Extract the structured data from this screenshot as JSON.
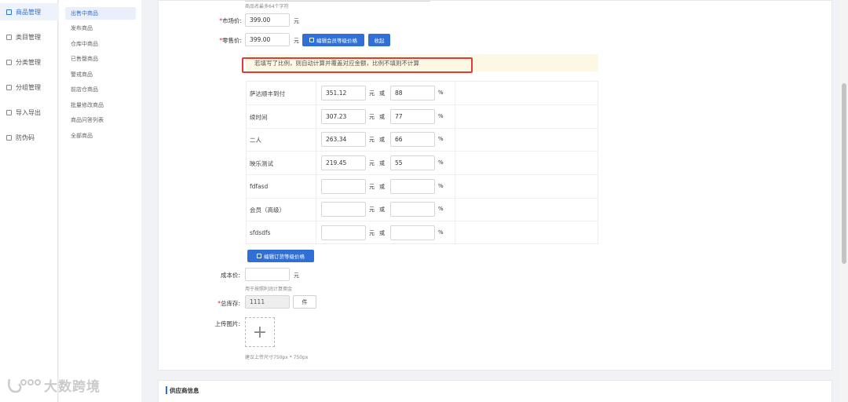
{
  "left_nav": [
    {
      "label": "商品管理",
      "icon": "goods-icon",
      "active": true
    },
    {
      "label": "类目管理",
      "icon": "category-icon",
      "active": false
    },
    {
      "label": "分类管理",
      "icon": "classify-icon",
      "active": false
    },
    {
      "label": "分组管理",
      "icon": "group-icon",
      "active": false
    },
    {
      "label": "导入导出",
      "icon": "import-export-icon",
      "active": false
    },
    {
      "label": "防伪码",
      "icon": "anti-fake-icon",
      "active": false
    }
  ],
  "sub_nav": [
    {
      "label": "出售中商品",
      "active": true
    },
    {
      "label": "发布商品",
      "active": false
    },
    {
      "label": "仓库中商品",
      "active": false
    },
    {
      "label": "已售罄商品",
      "active": false
    },
    {
      "label": "警戒商品",
      "active": false
    },
    {
      "label": "前店仓商品",
      "active": false
    },
    {
      "label": "批量修改商品",
      "active": false
    },
    {
      "label": "商品问答列表",
      "active": false
    },
    {
      "label": "全部商品",
      "active": false
    }
  ],
  "form": {
    "name_hint": "商品名最多64个字符",
    "market_price": {
      "required_mark": "*",
      "label": "市场价:",
      "value": "399.00",
      "unit": "元"
    },
    "retail_price": {
      "required_mark": "*",
      "label": "零售价:",
      "value": "399.00",
      "unit": "元"
    },
    "edit_member_price_button": "编辑会员等级价格",
    "collapse_button": "收起",
    "notice": "若填写了比例，则自动计算并覆盖对应金额，比例不填则不计算",
    "member_prices": [
      {
        "name": "萨达顺丰到付",
        "amount": "351.12",
        "percent": "88"
      },
      {
        "name": "续时间",
        "amount": "307.23",
        "percent": "77"
      },
      {
        "name": "二人",
        "amount": "263.34",
        "percent": "66"
      },
      {
        "name": "映乐测试",
        "amount": "219.45",
        "percent": "55"
      },
      {
        "name": "fdfasd",
        "amount": "",
        "percent": ""
      },
      {
        "name": "会员（高级）",
        "amount": "",
        "percent": ""
      },
      {
        "name": "sfdsdfs",
        "amount": "",
        "percent": ""
      }
    ],
    "yuan_unit": "元",
    "or_text": "或",
    "percent_sign": "%",
    "edit_order_price_button": "编辑订货等级价格",
    "cost_price": {
      "label": "成本价:",
      "value": "",
      "unit": "元",
      "hint": "用于按照利润计算佣金"
    },
    "total_stock": {
      "required_mark": "*",
      "label": "总库存:",
      "value": "1111",
      "unit_button": "件"
    },
    "upload_image": {
      "label": "上传图片:",
      "icon": "plus-icon",
      "hint": "建议上传尺寸750px * 750px"
    }
  },
  "supplier_section_title": "供应商信息",
  "watermark": {
    "text": "大数跨境",
    "logo": "big-data-logo-icon"
  }
}
